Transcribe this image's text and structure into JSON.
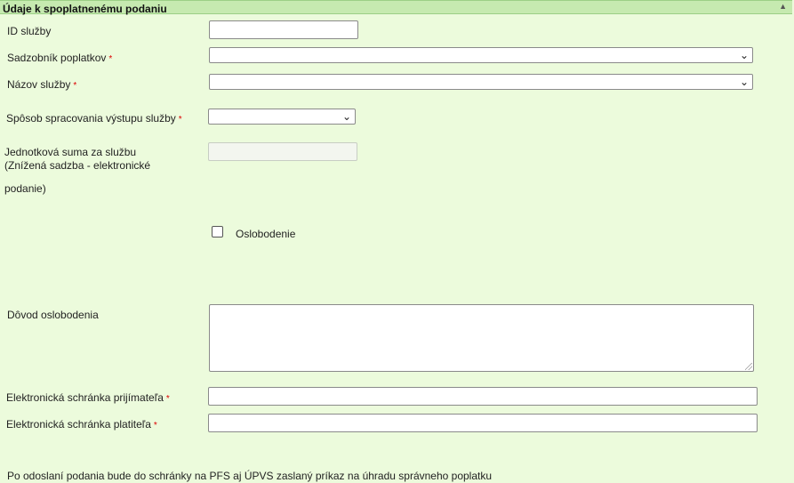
{
  "section": {
    "title": "Údaje k spoplatnenému podaniu",
    "collapse_icon": "chevron-up-icon"
  },
  "fields": {
    "service_id": {
      "label": "ID služby",
      "value": ""
    },
    "fee_schedule": {
      "label": "Sadzobník poplatkov",
      "required_mark": "*",
      "selected": ""
    },
    "service_name": {
      "label": "Názov služby",
      "required_mark": "*",
      "selected": ""
    },
    "output_processing": {
      "label": "Spôsob spracovania výstupu služby",
      "required_mark": "*",
      "selected": ""
    },
    "unit_amount": {
      "label_line1": "Jednotková suma za službu",
      "label_line2": "(Znížená sadzba - elektronické",
      "label_line3": "podanie)",
      "value": ""
    },
    "exemption": {
      "label": "Oslobodenie",
      "checked": false
    },
    "exemption_reason": {
      "label": "Dôvod oslobodenia",
      "value": ""
    },
    "recipient_mailbox": {
      "label": "Elektronická schránka prijímateľa",
      "required_mark": "*",
      "value": ""
    },
    "payer_mailbox": {
      "label": "Elektronická schránka platiteľa",
      "required_mark": "*",
      "value": ""
    }
  },
  "footer_note": "Po odoslaní podania bude do schránky na PFS aj ÚPVS zaslaný príkaz na úhradu správneho poplatku",
  "colors": {
    "background": "#ecfbdc",
    "header": "#c6eab0",
    "required": "#dd0000"
  }
}
